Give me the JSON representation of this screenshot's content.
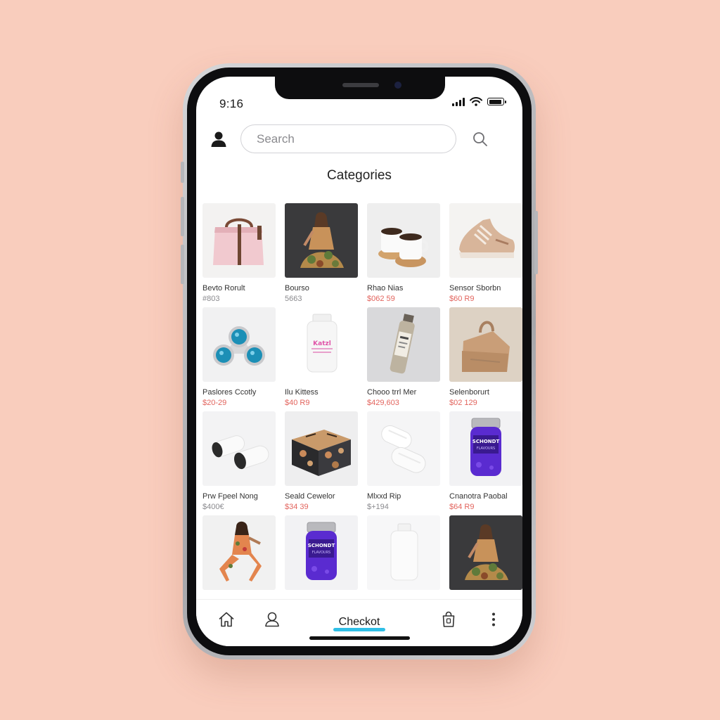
{
  "status_bar": {
    "time": "9:16",
    "battery_level": 0.9
  },
  "search": {
    "placeholder": "Search"
  },
  "section": {
    "title": "Categories"
  },
  "products": [
    {
      "name": "Bevto Rorult",
      "price": "#803",
      "price_style": "muted",
      "image": "pink-handbag"
    },
    {
      "name": "Bourso",
      "price": "5663",
      "price_style": "muted",
      "image": "woman-floral-dress-dark"
    },
    {
      "name": "Rhao Nias",
      "price": "$062 59",
      "price_style": "sale",
      "image": "coffee-cups"
    },
    {
      "name": "Sensor Sborbn",
      "price": "$60 R9",
      "price_style": "sale",
      "image": "beige-sneaker"
    },
    {
      "name": "Paslores Ccotly",
      "price": "$20-29",
      "price_style": "sale",
      "image": "blue-fidget-spinner"
    },
    {
      "name": "Ilu Kittess",
      "price": "$40 R9",
      "price_style": "sale",
      "image": "white-supplement-bottle"
    },
    {
      "name": "Chooo trrl Mer",
      "price": "$429,603",
      "price_style": "sale",
      "image": "spray-bottle"
    },
    {
      "name": "Selenborurt",
      "price": "$02 129",
      "price_style": "sale",
      "image": "paper-bag"
    },
    {
      "name": "Prw Fpeel Nong",
      "price": "$400€",
      "price_style": "muted",
      "image": "white-rollers"
    },
    {
      "name": "Seald Cewelor",
      "price": "$34 39",
      "price_style": "sale",
      "image": "patterned-box"
    },
    {
      "name": "Mlxxd Rip",
      "price": "$+194",
      "price_style": "muted",
      "image": "white-towels"
    },
    {
      "name": "Cnanotra Paobal",
      "price": "$64 R9",
      "price_style": "sale",
      "image": "purple-jar"
    },
    {
      "name": "",
      "price": "",
      "price_style": "muted",
      "image": "woman-floral-dress-light"
    },
    {
      "name": "",
      "price": "",
      "price_style": "muted",
      "image": "purple-jar"
    },
    {
      "name": "",
      "price": "",
      "price_style": "muted",
      "image": "white-bottle"
    },
    {
      "name": "",
      "price": "",
      "price_style": "muted",
      "image": "woman-floral-dress-dark"
    }
  ],
  "jar_label": {
    "line1": "SCHONDT",
    "line2": "FLAVOURS"
  },
  "bottle_label": "Katzl",
  "bottom_nav": {
    "checkout_label": "Checkot",
    "icons": [
      "home-icon",
      "profile-icon",
      "bag-icon",
      "more-icon"
    ]
  },
  "colors": {
    "background": "#f9cdbd",
    "accent": "#2fbfe6",
    "sale_price": "#e2645d",
    "muted_price": "#8a8a8e"
  }
}
